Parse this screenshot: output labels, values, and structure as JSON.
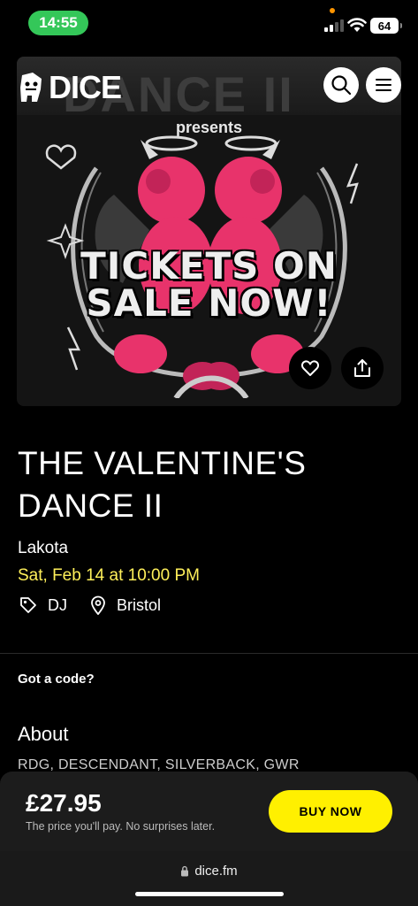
{
  "status_bar": {
    "time": "14:55",
    "battery": "64",
    "icons": [
      "signal-icon",
      "wifi-icon",
      "battery-icon"
    ]
  },
  "header": {
    "logo_text": "DICE",
    "search_icon": "search-icon",
    "menu_icon": "menu-icon"
  },
  "hero": {
    "banner_text": "DANCE II",
    "presents": "presents",
    "headline_line1": "TICKETS ON",
    "headline_line2": "SALE NOW!",
    "favorite_icon": "heart-icon",
    "share_icon": "share-icon"
  },
  "event": {
    "title": "THE VALENTINE'S DANCE II",
    "venue": "Lakota",
    "datetime": "Sat, Feb 14 at 10:00 PM",
    "genre": "DJ",
    "city": "Bristol"
  },
  "code_link": "Got a code?",
  "about": {
    "heading": "About",
    "text": "RDG, DESCENDANT, SILVERBACK, GWR"
  },
  "purchase": {
    "price": "£27.95",
    "note": "The price you'll pay. No surprises later.",
    "button": "BUY NOW"
  },
  "browser": {
    "url": "dice.fm"
  },
  "colors": {
    "accent_yellow": "#fff000",
    "date_yellow": "#fff05a",
    "status_green": "#34c759",
    "background": "#000000"
  }
}
